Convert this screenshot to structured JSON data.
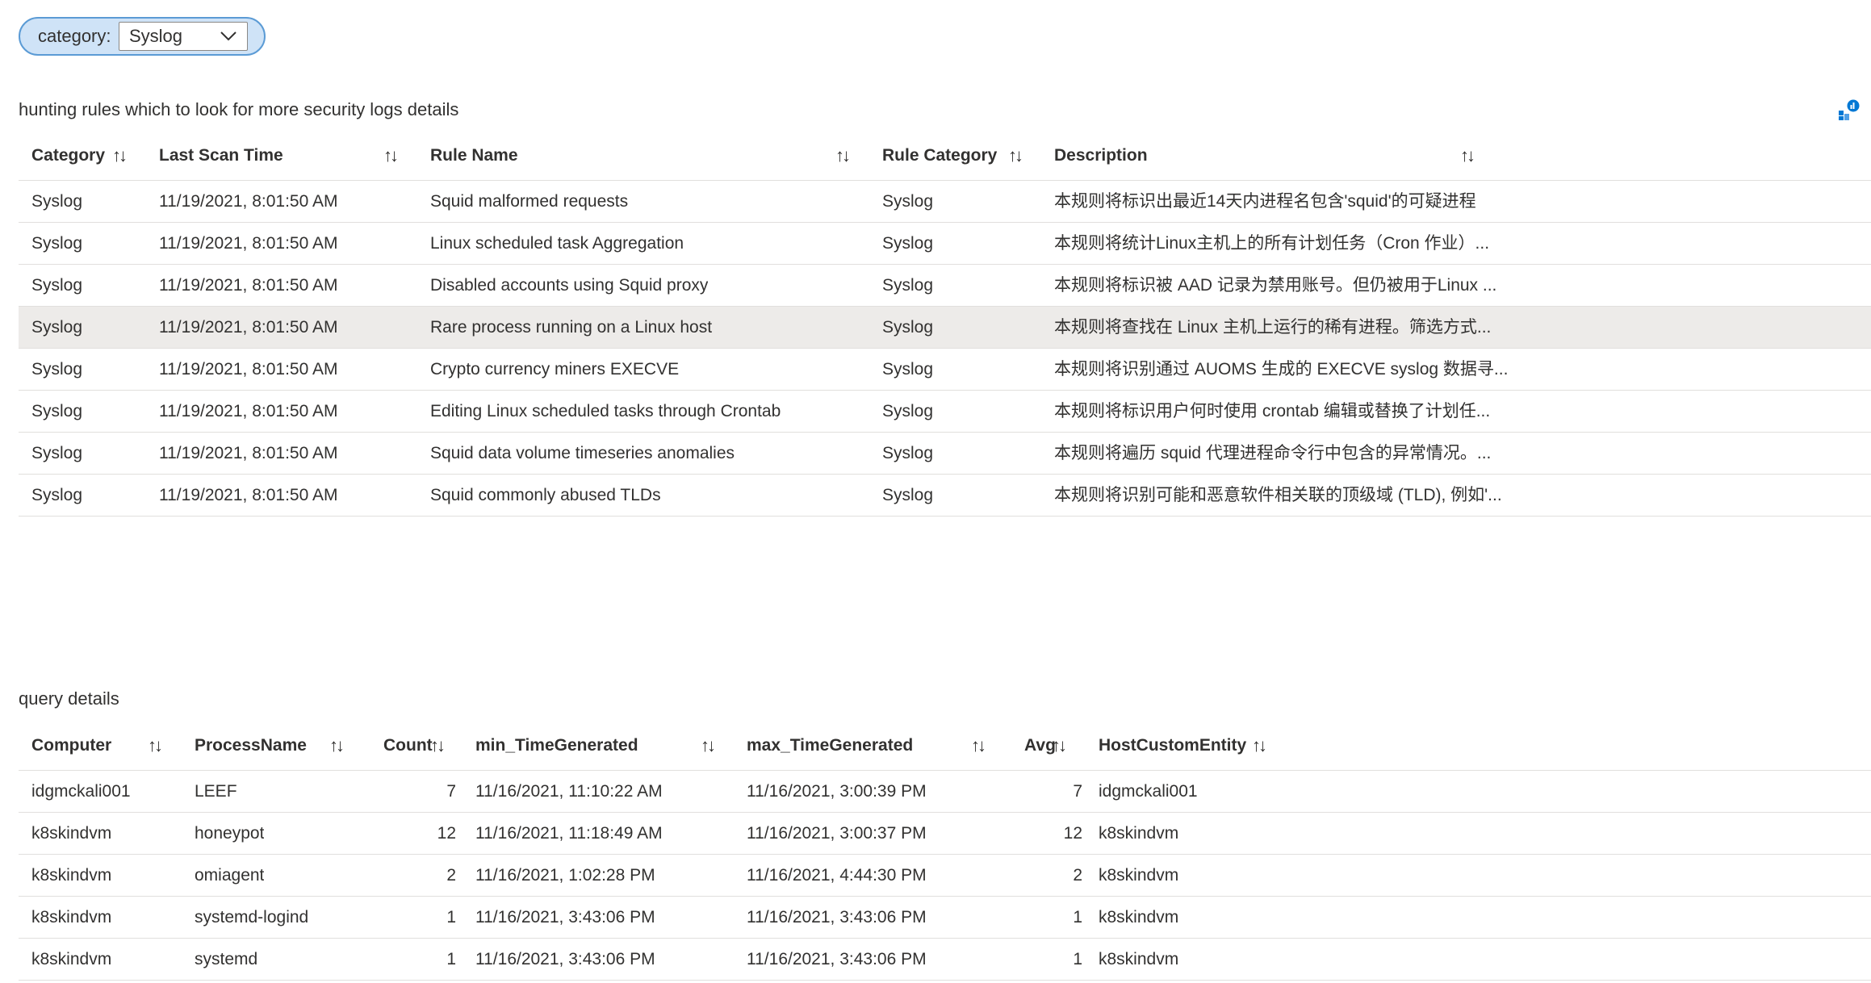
{
  "filter": {
    "label": "category:",
    "value": "Syslog"
  },
  "hunting": {
    "title": "hunting rules which to look for more security logs details",
    "columns": [
      "Category",
      "Last Scan Time",
      "Rule Name",
      "Rule Category",
      "Description"
    ],
    "sort_glyph": "↑↓",
    "rows": [
      {
        "category": "Syslog",
        "last_scan": "11/19/2021, 8:01:50 AM",
        "rule_name": "Squid malformed requests",
        "rule_category": "Syslog",
        "description": "本规则将标识出最近14天内进程名包含'squid'的可疑进程"
      },
      {
        "category": "Syslog",
        "last_scan": "11/19/2021, 8:01:50 AM",
        "rule_name": "Linux scheduled task Aggregation",
        "rule_category": "Syslog",
        "description": "本规则将统计Linux主机上的所有计划任务（Cron 作业）..."
      },
      {
        "category": "Syslog",
        "last_scan": "11/19/2021, 8:01:50 AM",
        "rule_name": "Disabled accounts using Squid proxy",
        "rule_category": "Syslog",
        "description": "本规则将标识被 AAD 记录为禁用账号。但仍被用于Linux ..."
      },
      {
        "category": "Syslog",
        "last_scan": "11/19/2021, 8:01:50 AM",
        "rule_name": "Rare process running on a Linux host",
        "rule_category": "Syslog",
        "description": "本规则将查找在 Linux 主机上运行的稀有进程。筛选方式..."
      },
      {
        "category": "Syslog",
        "last_scan": "11/19/2021, 8:01:50 AM",
        "rule_name": "Crypto currency miners EXECVE",
        "rule_category": "Syslog",
        "description": "本规则将识别通过 AUOMS 生成的 EXECVE syslog 数据寻..."
      },
      {
        "category": "Syslog",
        "last_scan": "11/19/2021, 8:01:50 AM",
        "rule_name": "Editing Linux scheduled tasks through Crontab",
        "rule_category": "Syslog",
        "description": "本规则将标识用户何时使用 crontab 编辑或替换了计划任..."
      },
      {
        "category": "Syslog",
        "last_scan": "11/19/2021, 8:01:50 AM",
        "rule_name": "Squid data volume timeseries anomalies",
        "rule_category": "Syslog",
        "description": "本规则将遍历 squid 代理进程命令行中包含的异常情况。..."
      },
      {
        "category": "Syslog",
        "last_scan": "11/19/2021, 8:01:50 AM",
        "rule_name": "Squid commonly abused TLDs",
        "rule_category": "Syslog",
        "description": "本规则将识别可能和恶意软件相关联的顶级域 (TLD), 例如'..."
      }
    ]
  },
  "query": {
    "title": "query details",
    "columns": [
      "Computer",
      "ProcessName",
      "Count",
      "min_TimeGenerated",
      "max_TimeGenerated",
      "Avg",
      "HostCustomEntity"
    ],
    "rows": [
      {
        "computer": "idgmckali001",
        "process": "LEEF",
        "count": "7",
        "min": "11/16/2021, 11:10:22 AM",
        "max": "11/16/2021, 3:00:39 PM",
        "avg": "7",
        "host": "idgmckali001"
      },
      {
        "computer": "k8skindvm",
        "process": "honeypot",
        "count": "12",
        "min": "11/16/2021, 11:18:49 AM",
        "max": "11/16/2021, 3:00:37 PM",
        "avg": "12",
        "host": "k8skindvm"
      },
      {
        "computer": "k8skindvm",
        "process": "omiagent",
        "count": "2",
        "min": "11/16/2021, 1:02:28 PM",
        "max": "11/16/2021, 4:44:30 PM",
        "avg": "2",
        "host": "k8skindvm"
      },
      {
        "computer": "k8skindvm",
        "process": "systemd-logind",
        "count": "1",
        "min": "11/16/2021, 3:43:06 PM",
        "max": "11/16/2021, 3:43:06 PM",
        "avg": "1",
        "host": "k8skindvm"
      },
      {
        "computer": "k8skindvm",
        "process": "systemd",
        "count": "1",
        "min": "11/16/2021, 3:43:06 PM",
        "max": "11/16/2021, 3:43:06 PM",
        "avg": "1",
        "host": "k8skindvm"
      }
    ]
  },
  "icons": {
    "chart": "bar-chart-icon",
    "dropdown": "chevron-down-icon",
    "sort": "sort-icon"
  },
  "colors": {
    "pill_bg": "#cfe3f7",
    "pill_border": "#5b9bd5",
    "selected_row": "#edebe9",
    "divider": "#e1dfdd"
  }
}
